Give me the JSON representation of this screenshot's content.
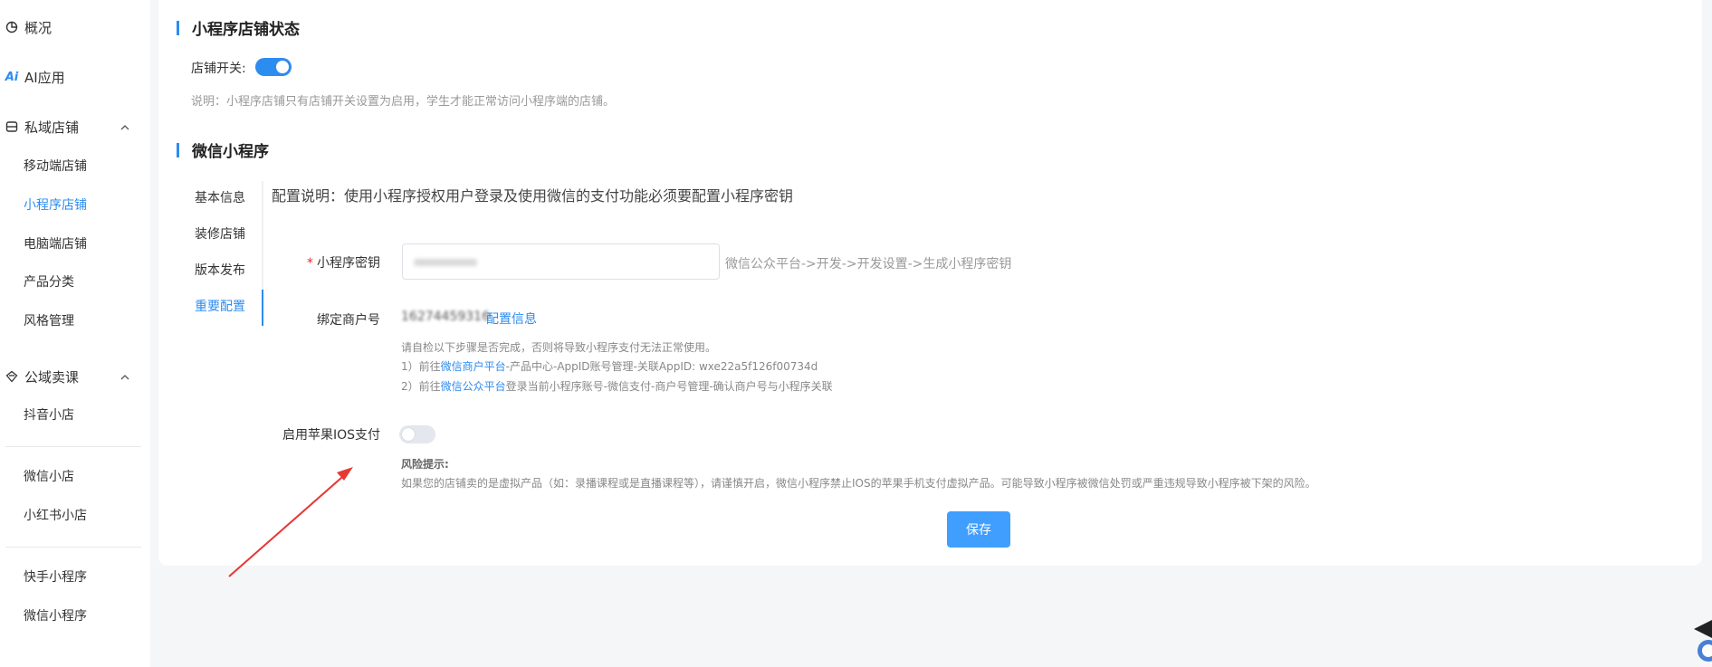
{
  "sidebar": {
    "overview": "概况",
    "ai_app": "AI应用",
    "private_store": "私域店铺",
    "private_items": [
      "移动端店铺",
      "小程序店铺",
      "电脑端店铺",
      "产品分类",
      "风格管理"
    ],
    "public_course": "公域卖课",
    "public_items": [
      "抖音小店",
      "微信小店",
      "小红书小店",
      "快手小程序",
      "微信小程序"
    ]
  },
  "status_section": {
    "title": "小程序店铺状态",
    "switch_label": "店铺开关:",
    "switch_on": true,
    "note": "说明：小程序店铺只有店铺开关设置为启用，学生才能正常访问小程序端的店铺。"
  },
  "wechat_section": {
    "title": "微信小程序",
    "tabs": [
      "基本信息",
      "装修店铺",
      "版本发布",
      "重要配置"
    ],
    "active_tab": "重要配置",
    "config_desc": "配置说明：使用小程序授权用户登录及使用微信的支付功能必须要配置小程序密钥",
    "secret_label": "小程序密钥",
    "secret_hint": "微信公众平台->开发->开发设置->生成小程序密钥",
    "merchant_label": "绑定商户号",
    "merchant_value": "16274459316",
    "merchant_link": "配置信息",
    "check_intro": "请自检以下步骤是否完成，否则将导致小程序支付无法正常使用。",
    "step1_prefix": "1）前往",
    "step1_link": "微信商户平台",
    "step1_suffix": "-产品中心-AppID账号管理-关联AppID: wxe22a5f126f00734d",
    "step2_prefix": "2）前往",
    "step2_link": "微信公众平台",
    "step2_suffix": "登录当前小程序账号-微信支付-商户号管理-确认商户号与小程序关联",
    "ios_label": "启用苹果IOS支付",
    "ios_on": false,
    "risk_title": "风险提示:",
    "risk_text": "如果您的店铺卖的是虚拟产品（如：录播课程或是直播课程等），请谨慎开启，微信小程序禁止IOS的苹果手机支付虚拟产品。可能导致小程序被微信处罚或严重违规导致小程序被下架的风险。",
    "save_label": "保存"
  },
  "colors": {
    "accent": "#2d8cf0",
    "annotation_arrow": "#e53935"
  }
}
